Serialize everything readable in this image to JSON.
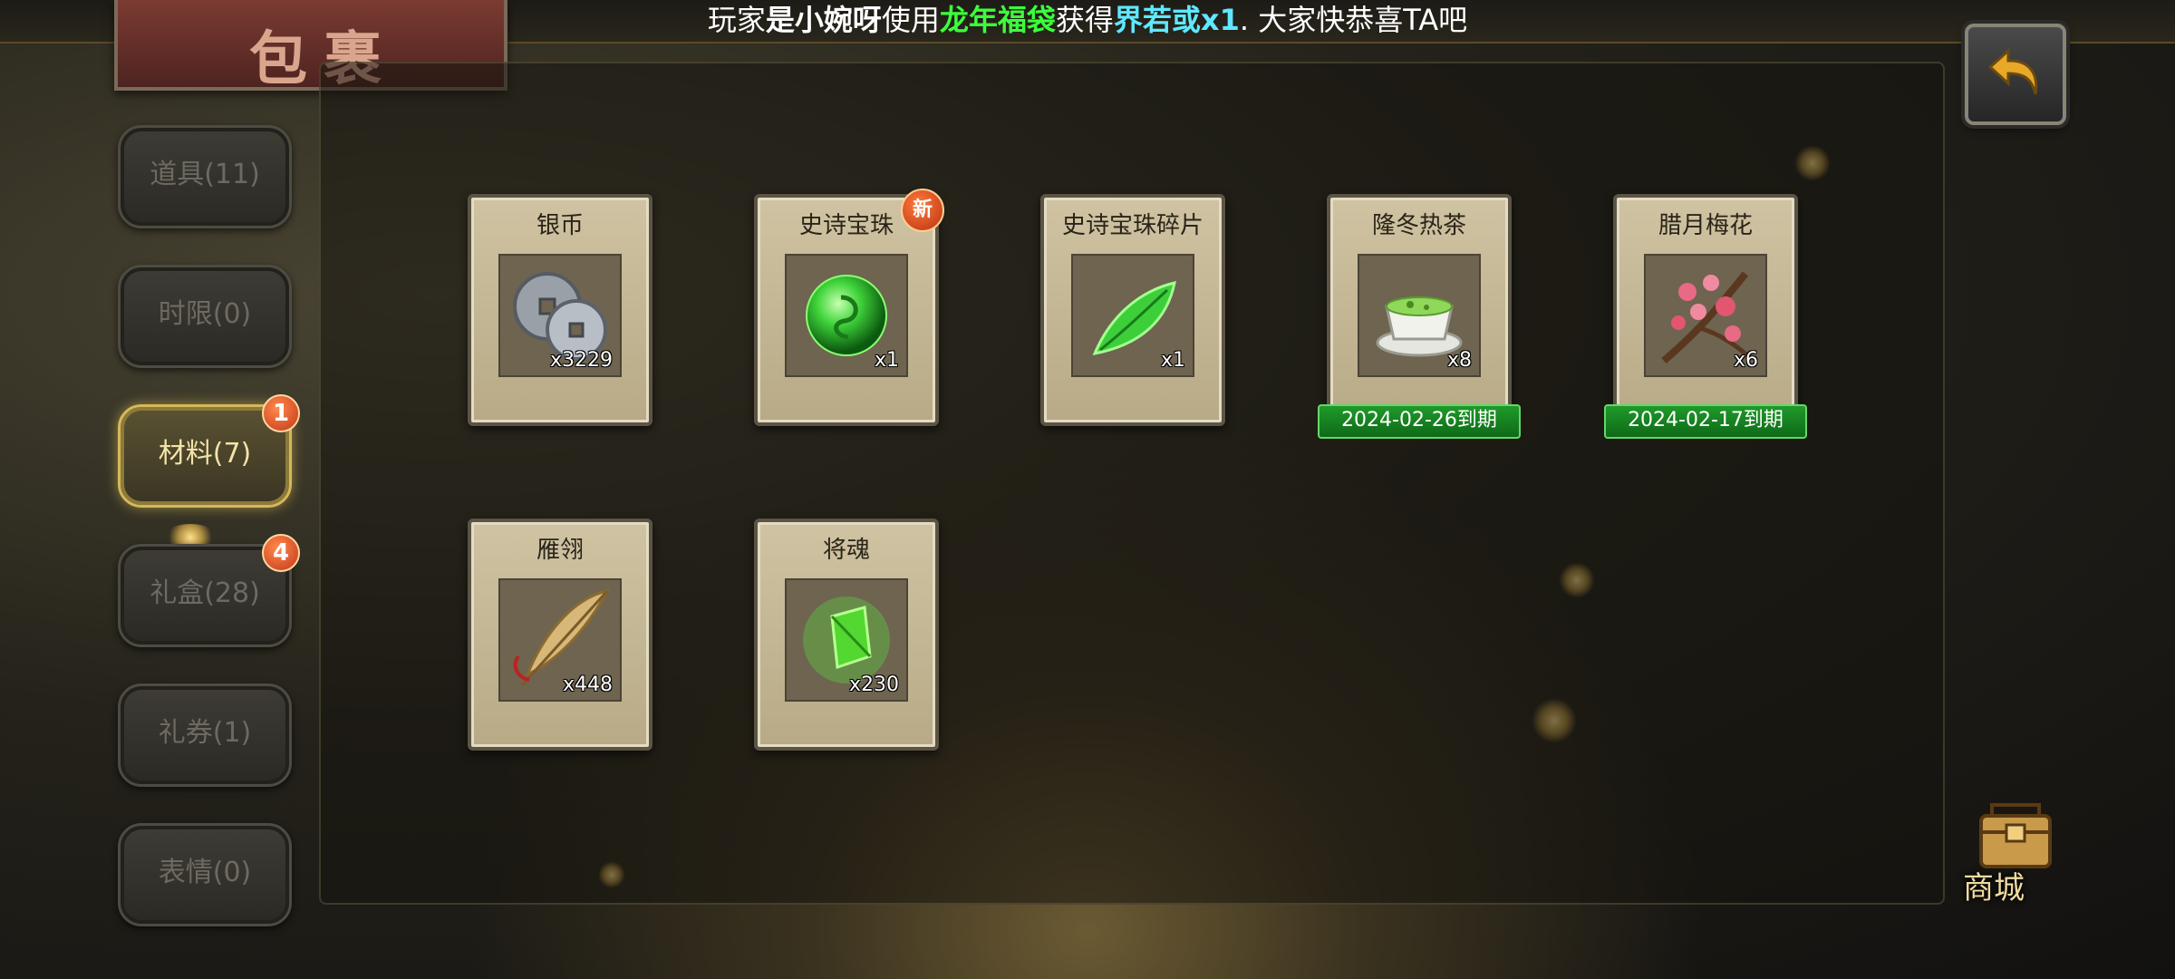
{
  "ticker": {
    "part1": "玩家",
    "player": "是小婉呀",
    "part2": "使用",
    "item_used": "龙年福袋",
    "part3": "获得",
    "reward": "界若或x1",
    "part4": ". 大家快恭喜TA吧"
  },
  "header": {
    "title": "包裹"
  },
  "tabs": [
    {
      "label": "道具(11)",
      "badge": "",
      "active": false
    },
    {
      "label": "时限(0)",
      "badge": "",
      "active": false
    },
    {
      "label": "材料(7)",
      "badge": "1",
      "active": true
    },
    {
      "label": "礼盒(28)",
      "badge": "4",
      "active": false
    },
    {
      "label": "礼券(1)",
      "badge": "",
      "active": false
    },
    {
      "label": "表情(0)",
      "badge": "",
      "active": false
    }
  ],
  "items": [
    {
      "name": "银币",
      "qty": "x3229",
      "icon": "silver-coin-icon",
      "new": "",
      "expiry": ""
    },
    {
      "name": "史诗宝珠",
      "qty": "x1",
      "icon": "green-orb-icon",
      "new": "新",
      "expiry": ""
    },
    {
      "name": "史诗宝珠碎片",
      "qty": "x1",
      "icon": "orb-shard-icon",
      "new": "",
      "expiry": ""
    },
    {
      "name": "隆冬热茶",
      "qty": "x8",
      "icon": "tea-cup-icon",
      "new": "",
      "expiry": "2024-02-26到期"
    },
    {
      "name": "腊月梅花",
      "qty": "x6",
      "icon": "plum-blossom-icon",
      "new": "",
      "expiry": "2024-02-17到期"
    },
    {
      "name": "雁翎",
      "qty": "x448",
      "icon": "feather-icon",
      "new": "",
      "expiry": ""
    },
    {
      "name": "将魂",
      "qty": "x230",
      "icon": "general-soul-icon",
      "new": "",
      "expiry": ""
    }
  ],
  "shop": {
    "label": "商城",
    "icon": "shop-chest-icon"
  },
  "back": {
    "icon": "back-arrow-icon"
  },
  "colors": {
    "highlight_green": "#3cff3c",
    "highlight_cyan": "#5fe8ff",
    "active_tab_border": "#d6b85a",
    "expiry_bar": "#1f9a2a",
    "badge": "#c4361a"
  }
}
